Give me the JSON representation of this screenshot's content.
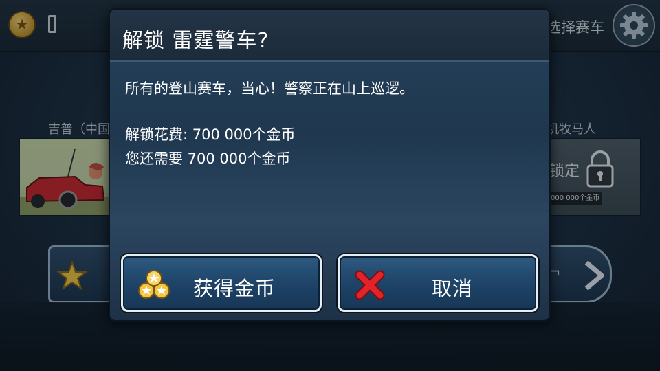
{
  "top_bar": {
    "select_car_label": "选择赛车",
    "icons": {
      "coin": "coin-star-icon",
      "settings": "gear-icon"
    }
  },
  "background": {
    "left_car_name": "吉普（中国",
    "right_car_name": "机牧马人",
    "right_car_lock_text": "锁定",
    "right_car_price": "000 000个金币"
  },
  "dialog": {
    "title": "解锁 雷霆警车?",
    "description": "所有的登山赛车，当心！警察正在山上巡逻。",
    "unlock_cost": "解锁花费:  700 000个金币",
    "still_need": "您还需要 700 000个金币",
    "get_coins_button": "获得金币",
    "cancel_button": "取消"
  },
  "colors": {
    "dialog_bg": "#1f3850",
    "button_bg": "#1e4468",
    "button_border": "#e6ecf1",
    "cancel_x": "#e0242a",
    "coin_gold": "#f2c640"
  }
}
